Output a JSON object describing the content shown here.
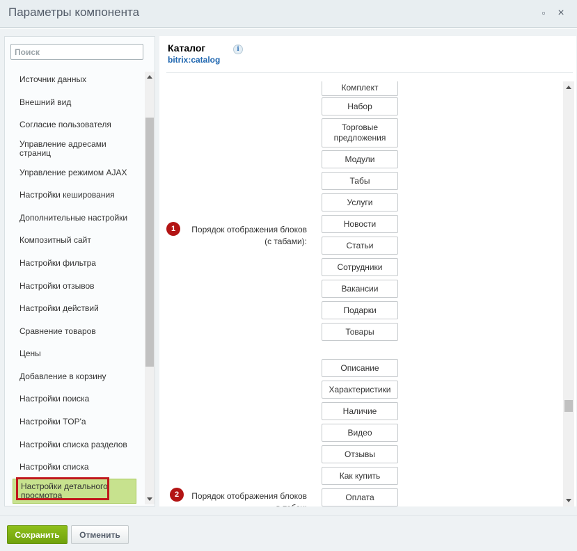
{
  "dialog": {
    "title": "Параметры компонента"
  },
  "sidebar": {
    "search_placeholder": "Поиск",
    "items": [
      {
        "label": "Источник данных"
      },
      {
        "label": "Внешний вид"
      },
      {
        "label": "Согласие пользователя"
      },
      {
        "label": "Управление адресами страниц"
      },
      {
        "label": "Управление режимом AJAX"
      },
      {
        "label": "Настройки кеширования"
      },
      {
        "label": "Дополнительные настройки"
      },
      {
        "label": "Композитный сайт"
      },
      {
        "label": "Настройки фильтра"
      },
      {
        "label": "Настройки отзывов"
      },
      {
        "label": "Настройки действий"
      },
      {
        "label": "Сравнение товаров"
      },
      {
        "label": "Цены"
      },
      {
        "label": "Добавление в корзину"
      },
      {
        "label": "Настройки поиска"
      },
      {
        "label": "Настройки TOP'а"
      },
      {
        "label": "Настройки списка разделов"
      },
      {
        "label": "Настройки списка"
      },
      {
        "label": "Настройки детального просмотра",
        "active": true
      }
    ]
  },
  "main": {
    "component_title": "Каталог",
    "component_code": "bitrix:catalog",
    "info_icon": "i",
    "fields": [
      {
        "badge": "1",
        "label": "Порядок отображения блоков (с табами):",
        "items": [
          "Комплект",
          "Набор",
          "Торговые предложения",
          "Модули",
          "Табы",
          "Услуги",
          "Новости",
          "Статьи",
          "Сотрудники",
          "Вакансии",
          "Подарки",
          "Товары"
        ]
      },
      {
        "badge": "2",
        "label": "Порядок отображения блоков в табах:",
        "items": [
          "Описание",
          "Характеристики",
          "Наличие",
          "Видео",
          "Отзывы",
          "Как купить",
          "Оплата"
        ]
      }
    ]
  },
  "footer": {
    "save_label": "Сохранить",
    "cancel_label": "Отменить"
  },
  "colors": {
    "save_button": "#7fb014",
    "active_item": "#c7e28e",
    "highlight_border": "#c0171c",
    "badge": "#b31414",
    "link": "#2067b0"
  }
}
